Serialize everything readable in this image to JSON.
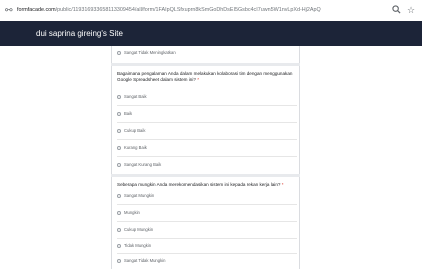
{
  "browser": {
    "url_host": "formfacade.com",
    "url_path": "/public/119316933658113309454/all/form/1FAIpQLSfxuprn8kSmGoDhDsEI5Gsbc4cI7uwn5W1nvLpXd-Hj2ApQ",
    "site_icon": "tune-icon",
    "search_icon": "magnifier-icon",
    "star_icon": "bookmark-star-icon"
  },
  "header": {
    "site_title": "dui saprina gireing's Site",
    "bg_color": "#1c2438"
  },
  "form": {
    "top_option": {
      "label": "Sangat Tidak Meningkatkan"
    },
    "questions": [
      {
        "text": "Bagaimana pengalaman Anda dalam melakukan kolaborasi tim dengan menggunakan Google Spreadsheet dalam sistem ini?",
        "required_mark": "*",
        "options": [
          "Sangat Baik",
          "Baik",
          "Cukup Baik",
          "Kurang Baik",
          "Sangat Kurang Baik"
        ]
      },
      {
        "text": "Seberapa mungkin Anda merekomendasikan sistem ini kepada rekan kerja lain?",
        "required_mark": "*",
        "options": [
          "Sangat Mungkin",
          "Mungkin",
          "Cukup Mungkin",
          "Tidak Mungkin",
          "Sangat Tidak Mungkin"
        ]
      }
    ]
  }
}
